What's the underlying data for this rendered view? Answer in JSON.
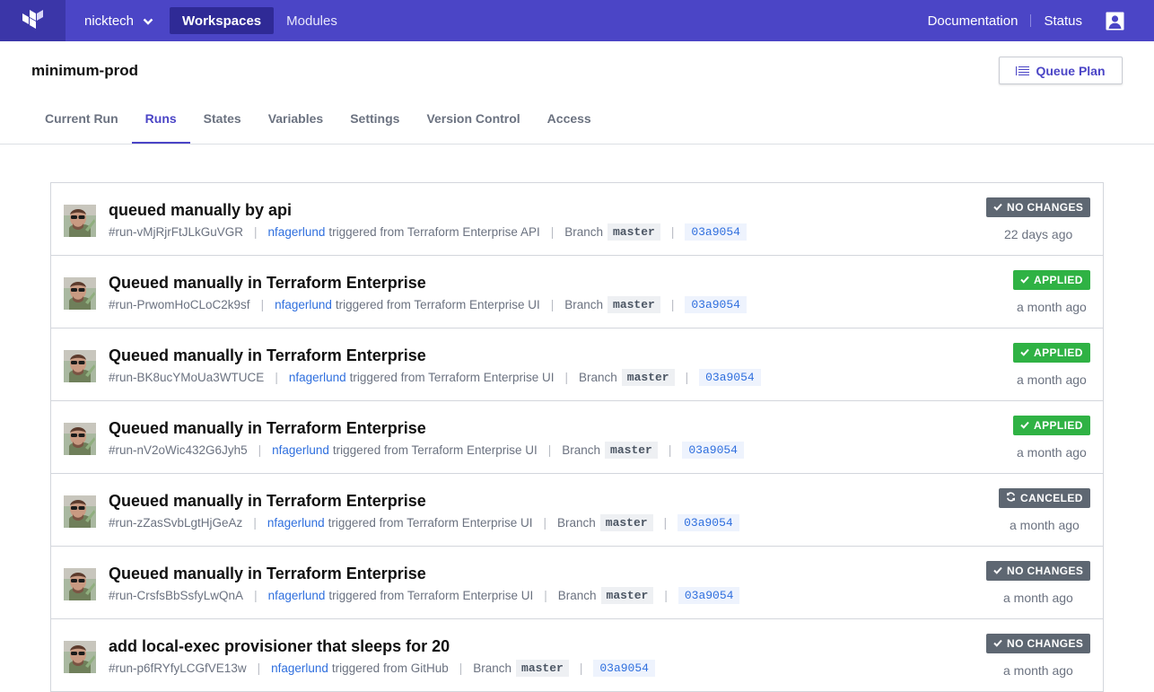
{
  "nav": {
    "org": "nicktech",
    "links": [
      "Workspaces",
      "Modules"
    ],
    "right_links": [
      "Documentation",
      "Status"
    ]
  },
  "workspace": {
    "name": "minimum-prod",
    "queue_plan_label": "Queue Plan"
  },
  "tabs": [
    "Current Run",
    "Runs",
    "States",
    "Variables",
    "Settings",
    "Version Control",
    "Access"
  ],
  "active_tab": "Runs",
  "runs": [
    {
      "title": "queued manually by api",
      "id": "#run-vMjRjrFtJLkGuVGR",
      "user": "nfagerlund",
      "trigger": "triggered from Terraform Enterprise API",
      "branch_label": "Branch",
      "branch": "master",
      "sha": "03a9054",
      "status": "NO CHANGES",
      "time": "22 days ago"
    },
    {
      "title": "Queued manually in Terraform Enterprise",
      "id": "#run-PrwomHoCLoC2k9sf",
      "user": "nfagerlund",
      "trigger": "triggered from Terraform Enterprise UI",
      "branch_label": "Branch",
      "branch": "master",
      "sha": "03a9054",
      "status": "APPLIED",
      "time": "a month ago"
    },
    {
      "title": "Queued manually in Terraform Enterprise",
      "id": "#run-BK8ucYMoUa3WTUCE",
      "user": "nfagerlund",
      "trigger": "triggered from Terraform Enterprise UI",
      "branch_label": "Branch",
      "branch": "master",
      "sha": "03a9054",
      "status": "APPLIED",
      "time": "a month ago"
    },
    {
      "title": "Queued manually in Terraform Enterprise",
      "id": "#run-nV2oWic432G6Jyh5",
      "user": "nfagerlund",
      "trigger": "triggered from Terraform Enterprise UI",
      "branch_label": "Branch",
      "branch": "master",
      "sha": "03a9054",
      "status": "APPLIED",
      "time": "a month ago"
    },
    {
      "title": "Queued manually in Terraform Enterprise",
      "id": "#run-zZasSvbLgtHjGeAz",
      "user": "nfagerlund",
      "trigger": "triggered from Terraform Enterprise UI",
      "branch_label": "Branch",
      "branch": "master",
      "sha": "03a9054",
      "status": "CANCELED",
      "time": "a month ago"
    },
    {
      "title": "Queued manually in Terraform Enterprise",
      "id": "#run-CrsfsBbSsfyLwQnA",
      "user": "nfagerlund",
      "trigger": "triggered from Terraform Enterprise UI",
      "branch_label": "Branch",
      "branch": "master",
      "sha": "03a9054",
      "status": "NO CHANGES",
      "time": "a month ago"
    },
    {
      "title": "add local-exec provisioner that sleeps for 20",
      "id": "#run-p6fRYfyLCGfVE13w",
      "user": "nfagerlund",
      "trigger": "triggered from GitHub",
      "branch_label": "Branch",
      "branch": "master",
      "sha": "03a9054",
      "status": "NO CHANGES",
      "time": "a month ago"
    }
  ],
  "colors": {
    "brand": "#4b45c6",
    "applied": "#2fb244",
    "neutral_status": "#5e6772",
    "link": "#2f6fde"
  },
  "icons": {
    "logo": "terraform-logo-icon",
    "org_toggle": "chevron-down-icon",
    "account": "user-account-icon",
    "queue_plan": "list-icon",
    "no_changes": "check-icon",
    "applied": "check-icon",
    "canceled": "refresh-icon"
  }
}
